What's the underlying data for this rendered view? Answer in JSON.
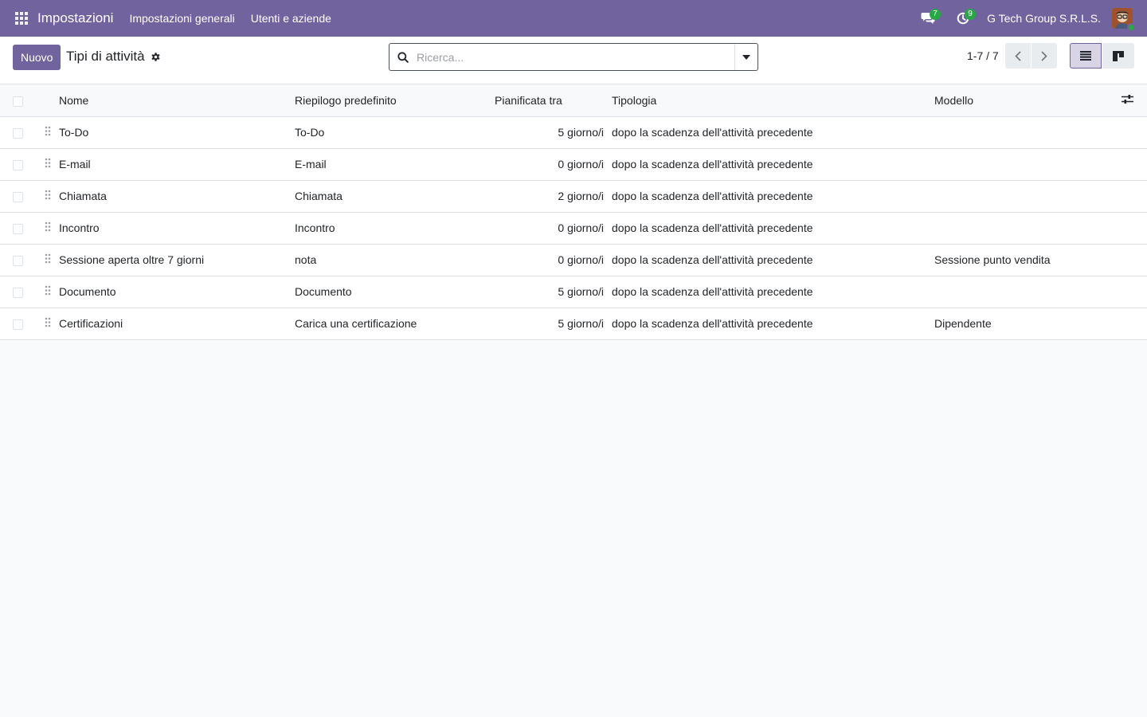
{
  "navbar": {
    "app_name": "Impostazioni",
    "menu": [
      "Impostazioni generali",
      "Utenti e aziende"
    ],
    "messages_count": "7",
    "activities_count": "9",
    "company": "G Tech Group S.R.L.S."
  },
  "control_panel": {
    "new_label": "Nuovo",
    "breadcrumb": "Tipi di attività",
    "search_placeholder": "Ricerca...",
    "pager": "1-7 / 7"
  },
  "table": {
    "headers": {
      "name": "Nome",
      "summary": "Riepilogo predefinito",
      "planned": "Pianificata tra",
      "type": "Tipologia",
      "model": "Modello"
    },
    "rows": [
      {
        "name": "To-Do",
        "summary": "To-Do",
        "planned": "5 giorno/i",
        "type": "dopo la scadenza dell'attività precedente",
        "model": ""
      },
      {
        "name": "E-mail",
        "summary": "E-mail",
        "planned": "0 giorno/i",
        "type": "dopo la scadenza dell'attività precedente",
        "model": ""
      },
      {
        "name": "Chiamata",
        "summary": "Chiamata",
        "planned": "2 giorno/i",
        "type": "dopo la scadenza dell'attività precedente",
        "model": ""
      },
      {
        "name": "Incontro",
        "summary": "Incontro",
        "planned": "0 giorno/i",
        "type": "dopo la scadenza dell'attività precedente",
        "model": ""
      },
      {
        "name": "Sessione aperta oltre 7 giorni",
        "summary": "nota",
        "planned": "0 giorno/i",
        "type": "dopo la scadenza dell'attività precedente",
        "model": "Sessione punto vendita"
      },
      {
        "name": "Documento",
        "summary": "Documento",
        "planned": "5 giorno/i",
        "type": "dopo la scadenza dell'attività precedente",
        "model": ""
      },
      {
        "name": "Certificazioni",
        "summary": "Carica una certificazione",
        "planned": "5 giorno/i",
        "type": "dopo la scadenza dell'attività precedente",
        "model": "Dipendente"
      }
    ]
  },
  "colors": {
    "brand": "#71639e",
    "badge": "#28a745"
  },
  "icons": {
    "apps": "apps-grid-icon",
    "messages": "chat-icon",
    "activities": "clock-icon",
    "settings": "gear-icon",
    "search": "search-icon",
    "dropdown": "caret-down-icon",
    "prev": "chevron-left-icon",
    "next": "chevron-right-icon",
    "list_view": "list-icon",
    "kanban_view": "kanban-icon",
    "optional_columns": "sliders-icon",
    "drag": "drag-handle-icon"
  }
}
